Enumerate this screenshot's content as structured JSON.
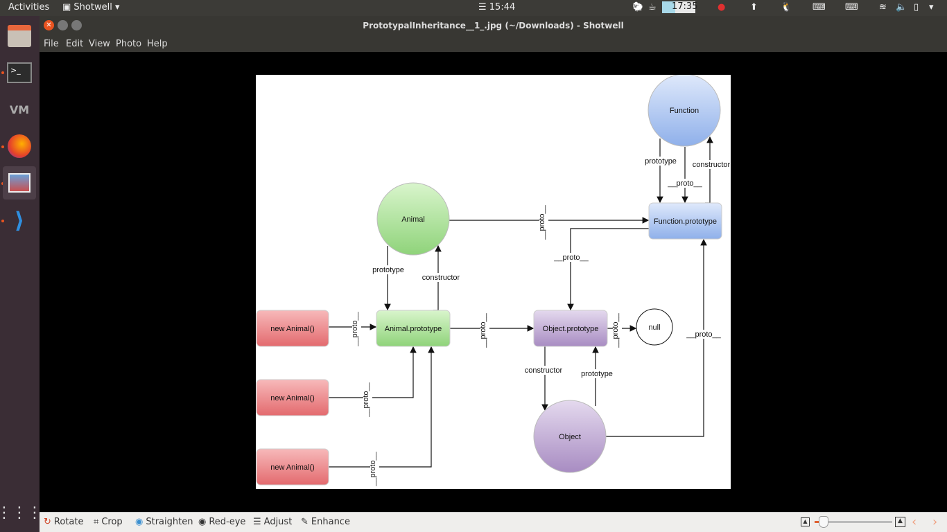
{
  "topbar": {
    "activities": "Activities",
    "app": "Shotwell",
    "clock": "☰ 15:44",
    "timer": "17:35"
  },
  "window": {
    "title": "PrototypalInheritance__1_.jpg (~/Downloads) - Shotwell"
  },
  "menu": [
    "File",
    "Edit",
    "View",
    "Photo",
    "Help"
  ],
  "toolbar": {
    "rotate": "Rotate",
    "crop": "Crop",
    "straighten": "Straighten",
    "redeye": "Red-eye",
    "adjust": "Adjust",
    "enhance": "Enhance",
    "zoom_level": 0.05
  },
  "dock": [
    "files-icon",
    "terminal-icon",
    "vmware-icon",
    "firefox-icon",
    "shotwell-icon",
    "vscode-icon"
  ],
  "diagram": {
    "nodes": {
      "function": "Function",
      "function_prototype": "Function.prototype",
      "animal": "Animal",
      "animal_prototype": "Animal.prototype",
      "object_prototype": "Object.prototype",
      "null": "null",
      "object": "Object",
      "new_animal": [
        "new Animal()",
        "new Animal()",
        "new Animal()"
      ]
    },
    "edges": {
      "prototype": "prototype",
      "constructor": "constructor",
      "proto": "__proto__",
      "proto_short": "__proto__"
    },
    "colors": {
      "green": "#9fd98a",
      "blue": "#a3bff0",
      "purple": "#b39bc8",
      "red": "#ec7f82"
    }
  }
}
